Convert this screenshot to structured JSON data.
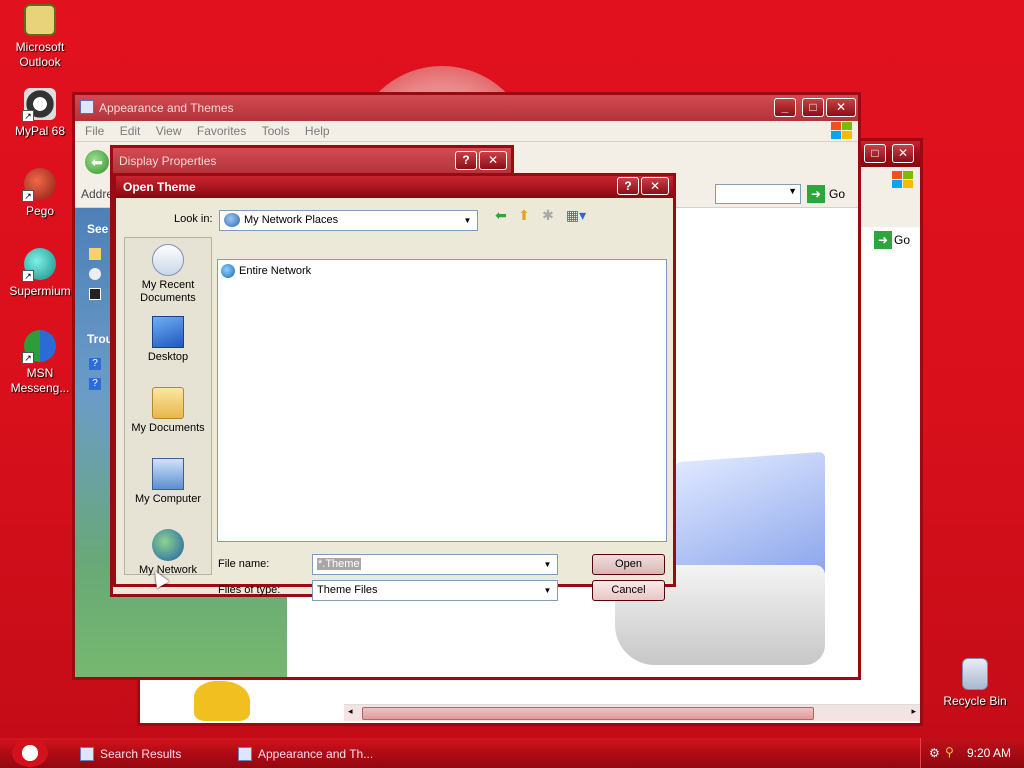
{
  "desktop_icons": [
    {
      "label": "Microsoft Outlook",
      "icon": "outlook-icon"
    },
    {
      "label": "MyPal 68",
      "icon": "mypal-icon"
    },
    {
      "label": "Pego",
      "icon": "pego-icon"
    },
    {
      "label": "Supermium",
      "icon": "supermium-icon"
    },
    {
      "label": "MSN Messeng...",
      "icon": "msn-messenger-icon"
    },
    {
      "label": "Recycle Bin",
      "icon": "recycle-bin-icon"
    }
  ],
  "appearance_window": {
    "title": "Appearance and Themes",
    "menu": [
      "File",
      "Edit",
      "View",
      "Favorites",
      "Tools",
      "Help"
    ],
    "address_label": "Addre",
    "go_label": "Go",
    "sidebar_see": "See",
    "sidebar_trou": "Trou"
  },
  "back_window": {
    "go_label": "Go"
  },
  "display_properties": {
    "title": "Display Properties",
    "help_btn": "?",
    "close_btn": "✕"
  },
  "open_theme": {
    "title": "Open Theme",
    "look_in_label": "Look in:",
    "look_in_value": "My Network Places",
    "places": [
      {
        "label": "My Recent Documents",
        "icon": "recent-documents-icon"
      },
      {
        "label": "Desktop",
        "icon": "desktop-icon"
      },
      {
        "label": "My Documents",
        "icon": "my-documents-icon"
      },
      {
        "label": "My Computer",
        "icon": "my-computer-icon"
      },
      {
        "label": "My Network",
        "icon": "my-network-icon"
      }
    ],
    "files": [
      {
        "name": "Entire Network",
        "icon": "globe-icon"
      }
    ],
    "file_name_label": "File name:",
    "file_name_value": "*.Theme",
    "file_type_label": "Files of type:",
    "file_type_value": "Theme Files",
    "open_btn": "Open",
    "cancel_btn": "Cancel"
  },
  "taskbar": {
    "tasks": [
      {
        "label": "Search Results"
      },
      {
        "label": "Appearance and Th..."
      }
    ],
    "clock": "9:20 AM"
  },
  "colors": {
    "desktop": "#d9101c",
    "titlebar": "#a10d15",
    "dialog_face": "#ece9d8"
  }
}
